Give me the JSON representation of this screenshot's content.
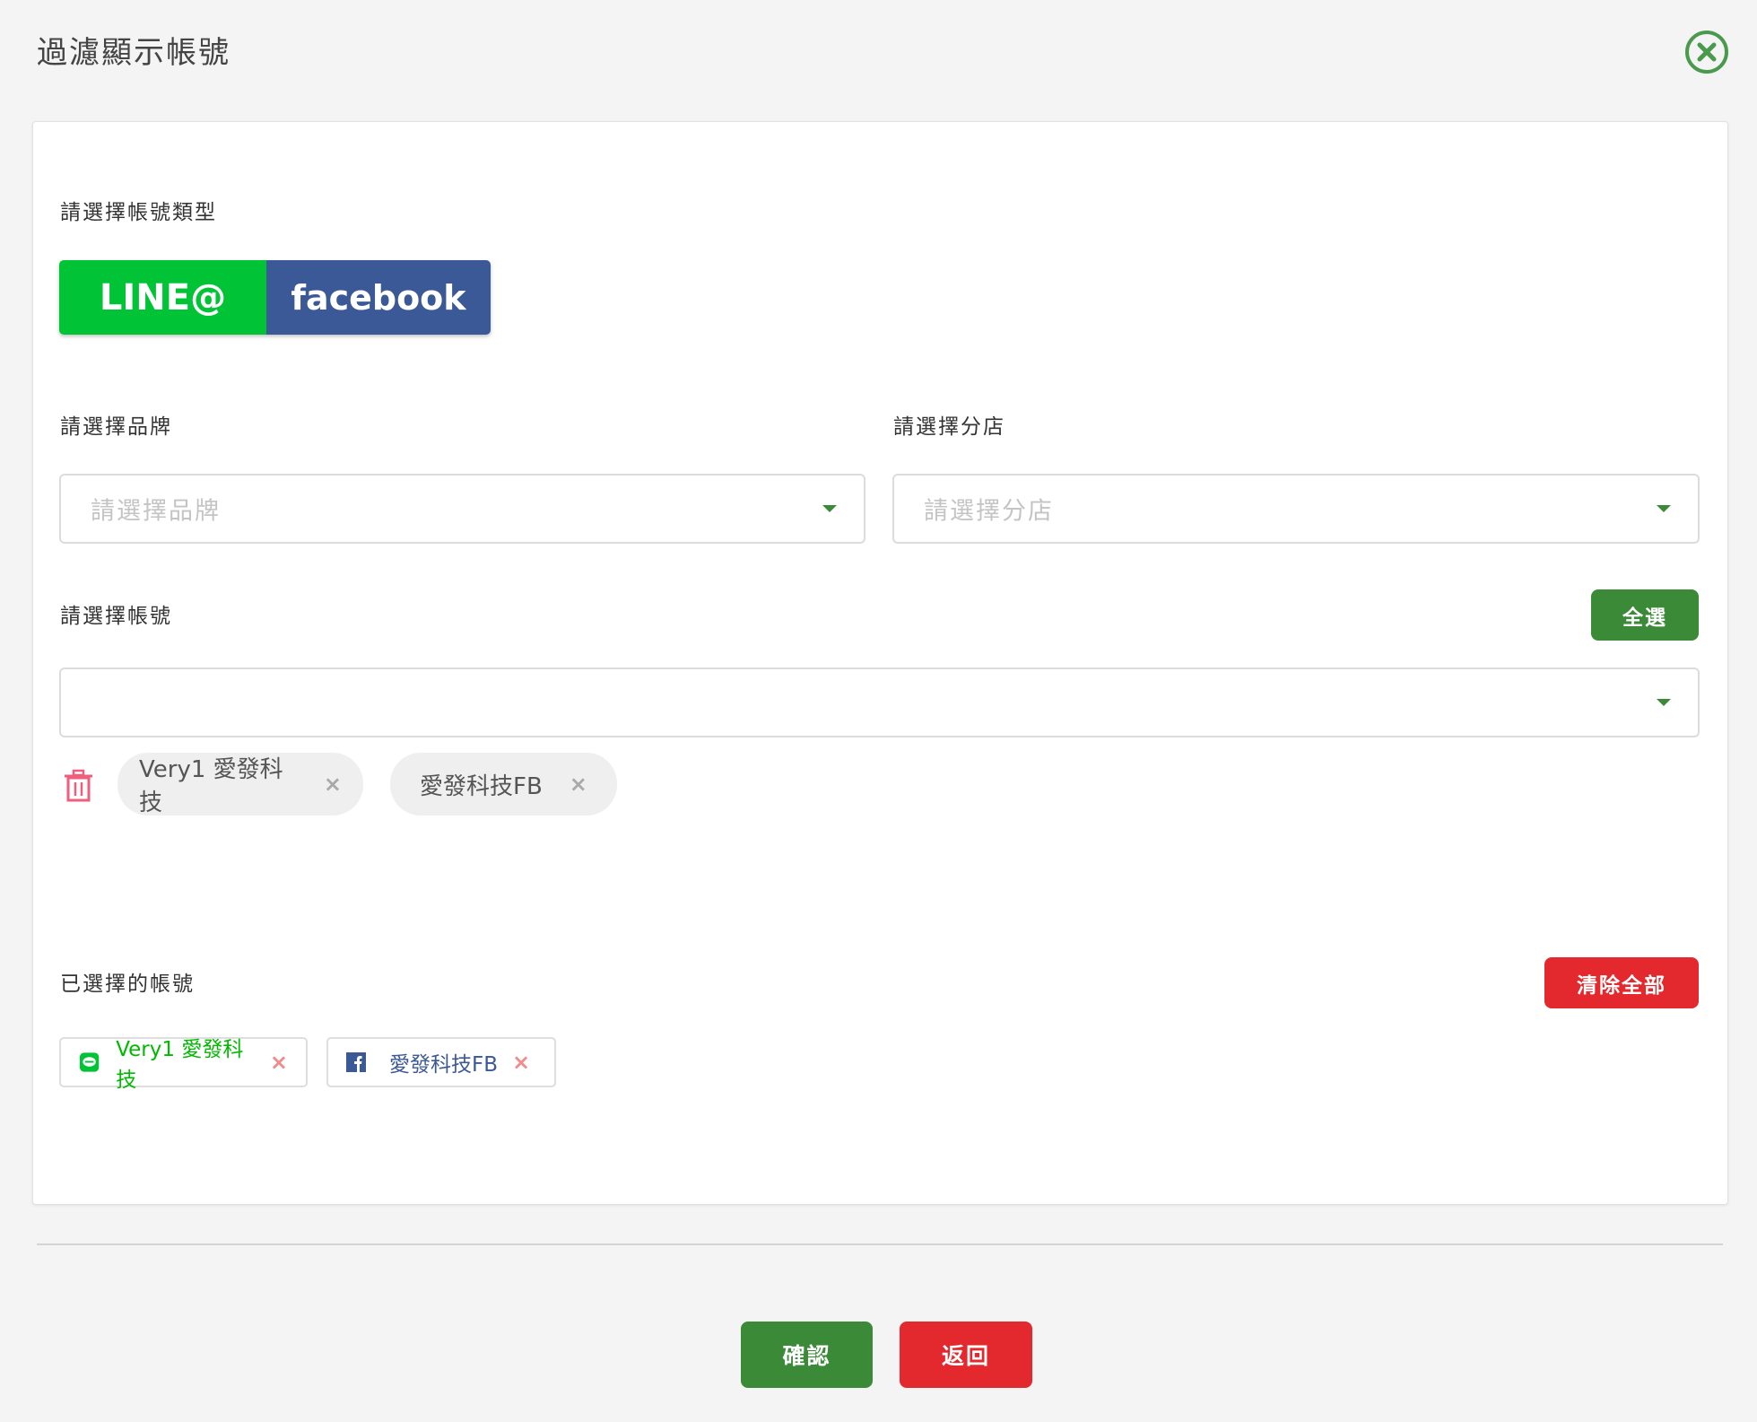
{
  "dialog": {
    "title": "過濾顯示帳號",
    "close_icon": "circle-x-icon"
  },
  "account_type": {
    "label": "請選擇帳號類型",
    "options": [
      {
        "label": "LINE@",
        "color": "#00c335"
      },
      {
        "label": "facebook",
        "color": "#3b5996"
      }
    ]
  },
  "brand": {
    "label": "請選擇品牌",
    "placeholder": "請選擇品牌",
    "value": ""
  },
  "branch": {
    "label": "請選擇分店",
    "placeholder": "請選擇分店",
    "value": ""
  },
  "account": {
    "label": "請選擇帳號",
    "select_all_label": "全選",
    "value": "",
    "chips": [
      {
        "label": "Very1 愛發科技",
        "remove": "×"
      },
      {
        "label": "愛發科技FB",
        "remove": "×"
      }
    ],
    "trash_icon": "trash-icon"
  },
  "selected": {
    "label": "已選擇的帳號",
    "clear_all_label": "清除全部",
    "tags": [
      {
        "type": "LINE",
        "icon": "line-icon",
        "label": "Very1 愛發科技",
        "remove": "×",
        "color": "#00b900"
      },
      {
        "type": "facebook",
        "icon": "facebook-icon",
        "label": "愛發科技FB",
        "remove": "×",
        "color": "#3b5996"
      }
    ]
  },
  "footer": {
    "confirm_label": "確認",
    "back_label": "返回"
  },
  "colors": {
    "primary_green": "#3a8a37",
    "danger_red": "#e3292d",
    "line_green": "#00c335",
    "facebook_blue": "#3b5996"
  }
}
